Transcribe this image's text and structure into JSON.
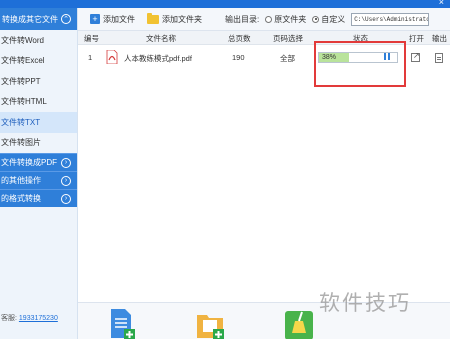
{
  "sidebar": {
    "header": "转换成其它文件",
    "items": [
      {
        "label": "文件转Word",
        "active": false
      },
      {
        "label": "文件转Excel",
        "active": false
      },
      {
        "label": "文件转PPT",
        "active": false
      },
      {
        "label": "文件转HTML",
        "active": false
      },
      {
        "label": "文件转TXT",
        "active": true
      },
      {
        "label": "文件转图片",
        "active": false
      }
    ],
    "groups": [
      {
        "label": "文件转换成PDF"
      },
      {
        "label": "的其他操作"
      },
      {
        "label": "的格式转换"
      }
    ],
    "footer": {
      "label": "客服:",
      "qq": "1933175230"
    }
  },
  "toolbar": {
    "add_file": "添加文件",
    "add_folder": "添加文件夹",
    "output_dir_label": "输出目录:",
    "radio_original": "原文件夹",
    "radio_custom": "自定义",
    "selected_radio": "custom",
    "path_value": "C:\\Users\\Administrator\\Desktop"
  },
  "table": {
    "columns": {
      "index": "编号",
      "name": "文件名称",
      "pages": "总页数",
      "page_select": "页码选择",
      "status": "状态",
      "open": "打开",
      "output": "输出"
    },
    "rows": [
      {
        "index": "1",
        "name": "人本教练模式pdf.pdf",
        "pages": "190",
        "page_select": "全部",
        "progress_text": "38%",
        "progress": 0.38
      }
    ]
  },
  "watermark": "软件技巧",
  "colors": {
    "accent": "#2f7fd9",
    "highlight": "#e23a3a",
    "progress_fill": "#b9e39b"
  }
}
